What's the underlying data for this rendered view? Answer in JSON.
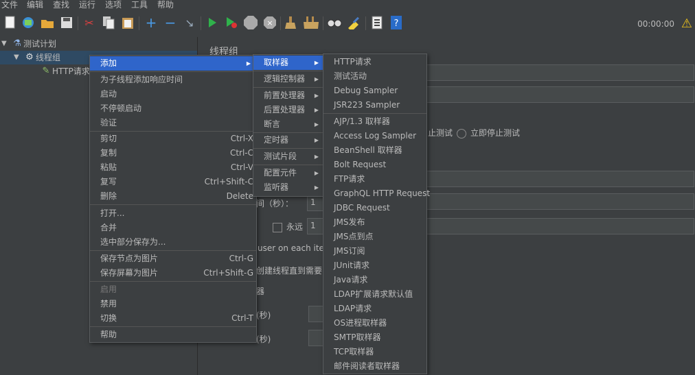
{
  "menubar": [
    "文件",
    "编辑",
    "查找",
    "运行",
    "选项",
    "工具",
    "帮助"
  ],
  "toolbar": {
    "icons": [
      "new-icon",
      "templates-icon",
      "open-icon",
      "save-icon",
      "cut-icon",
      "copy-icon",
      "paste-icon",
      "expand-icon",
      "collapse-icon",
      "toggle-icon",
      "start-icon",
      "start-no-pause-icon",
      "stop-icon",
      "shutdown-icon",
      "clear-icon",
      "clear-all-icon",
      "search-icon",
      "reset-search-icon",
      "function-helper-icon",
      "help-icon"
    ],
    "timer": "00:00:00"
  },
  "tree": {
    "test_plan": "测试计划",
    "thread_group": "线程组",
    "http_request": "HTTP请求"
  },
  "panel": {
    "title": "线程组",
    "stop_test": "止测试",
    "stop_now": "立即停止测试",
    "ramp_label": "间（秒）：",
    "ramp_value": "1",
    "forever": "永远",
    "loop_value": "1",
    "same_user": "user on each iterat",
    "delay_create": "创建线程直到需要",
    "scheduler_frag": "器",
    "duration_frag": "(秒)",
    "startup_frag": "(秒)"
  },
  "context_menu": {
    "add": "添加",
    "add_think_time": "为子线程添加响应时间",
    "start": "启动",
    "start_no_pause": "不停顿启动",
    "validate": "验证",
    "cut": "剪切",
    "cut_sc": "Ctrl-X",
    "copy": "复制",
    "copy_sc": "Ctrl-C",
    "paste": "粘贴",
    "paste_sc": "Ctrl-V",
    "duplicate": "复写",
    "duplicate_sc": "Ctrl+Shift-C",
    "delete": "删除",
    "delete_sc": "Delete",
    "open": "打开...",
    "merge": "合并",
    "save_selection": "选中部分保存为...",
    "save_node_img": "保存节点为图片",
    "save_node_img_sc": "Ctrl-G",
    "save_screen_img": "保存屏幕为图片",
    "save_screen_img_sc": "Ctrl+Shift-G",
    "enable": "启用",
    "disable": "禁用",
    "toggle": "切换",
    "toggle_sc": "Ctrl-T",
    "help": "帮助"
  },
  "add_menu": {
    "sampler": "取样器",
    "logic_controller": "逻辑控制器",
    "pre_processors": "前置处理器",
    "post_processors": "后置处理器",
    "assertions": "断言",
    "timer": "定时器",
    "test_fragment": "测试片段",
    "config_element": "配置元件",
    "listener": "监听器"
  },
  "sampler_menu": [
    "HTTP请求",
    "测试活动",
    "Debug Sampler",
    "JSR223 Sampler",
    "AJP/1.3 取样器",
    "Access Log Sampler",
    "BeanShell 取样器",
    "Bolt Request",
    "FTP请求",
    "GraphQL HTTP Request",
    "JDBC Request",
    "JMS发布",
    "JMS点到点",
    "JMS订阅",
    "JUnit请求",
    "Java请求",
    "LDAP扩展请求默认值",
    "LDAP请求",
    "OS进程取样器",
    "SMTP取样器",
    "TCP取样器",
    "邮件阅读者取样器"
  ],
  "colors": {
    "highlight": "#2f65ca",
    "background": "#3c3f41",
    "tree_selection": "#2f4a63"
  }
}
